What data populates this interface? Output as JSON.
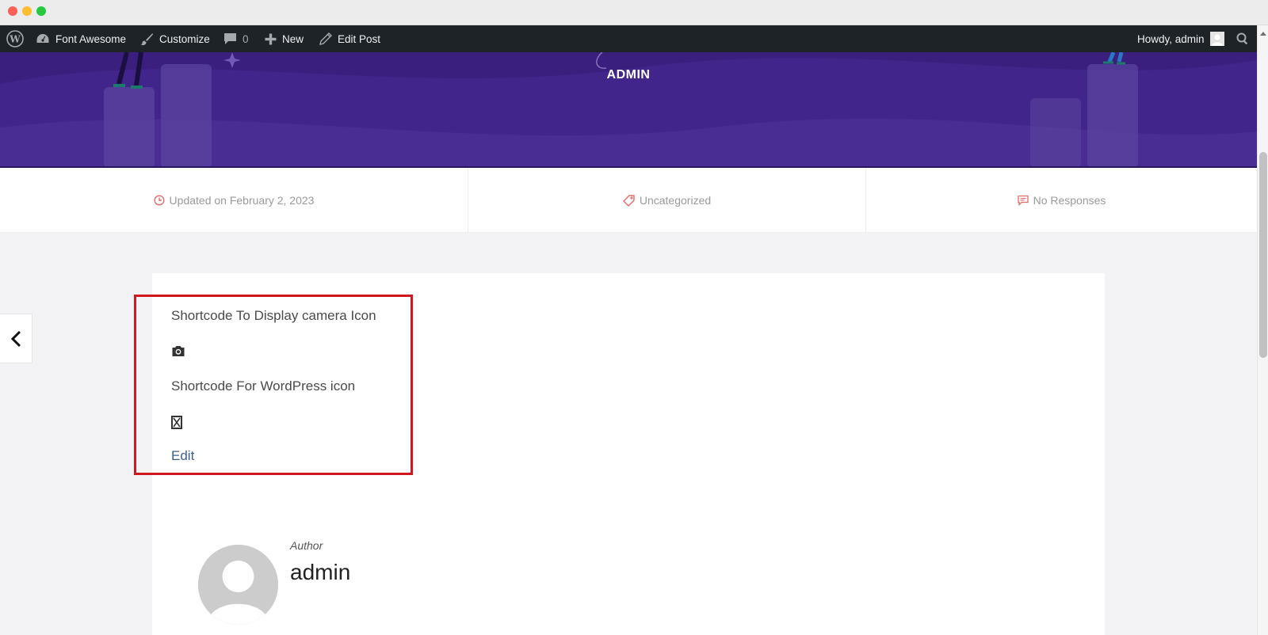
{
  "adminbar": {
    "items": [
      {
        "label": "Font Awesome"
      },
      {
        "label": "Customize"
      },
      {
        "count": "0"
      },
      {
        "label": "New"
      },
      {
        "label": "Edit Post"
      }
    ],
    "howdy": "Howdy, admin"
  },
  "hero": {
    "title": "ADMIN"
  },
  "meta": {
    "updated": "Updated on February 2, 2023",
    "category": "Uncategorized",
    "responses": "No Responses"
  },
  "content": {
    "line1": "Shortcode To Display camera Icon",
    "line2": "Shortcode For WordPress icon",
    "edit": "Edit"
  },
  "author": {
    "label": "Author",
    "name": "admin"
  },
  "colors": {
    "adminbar": "#1d2327",
    "hero": "#3b1f7f",
    "highlight": "#d0161f",
    "link": "#3d5f8f"
  }
}
